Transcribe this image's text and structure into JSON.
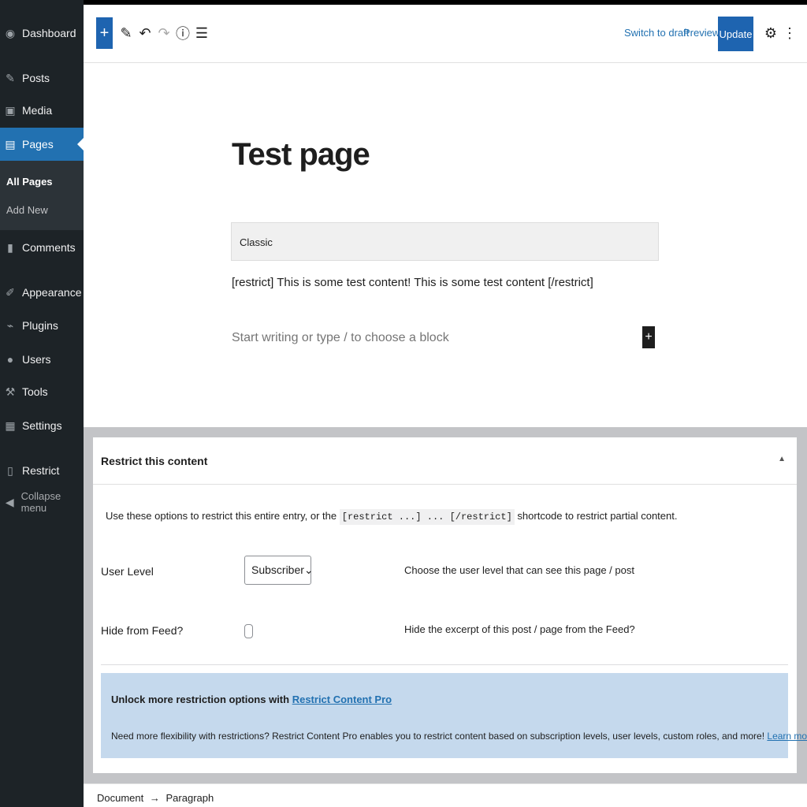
{
  "sidebar": {
    "items": [
      {
        "label": "Dashboard",
        "icon": "dashboard-icon"
      },
      {
        "label": "Posts",
        "icon": "pin-icon"
      },
      {
        "label": "Media",
        "icon": "media-icon"
      },
      {
        "label": "Pages",
        "icon": "pages-icon"
      },
      {
        "label": "Comments",
        "icon": "comment-icon"
      },
      {
        "label": "Appearance",
        "icon": "brush-icon"
      },
      {
        "label": "Plugins",
        "icon": "plugin-icon"
      },
      {
        "label": "Users",
        "icon": "user-icon"
      },
      {
        "label": "Tools",
        "icon": "wrench-icon"
      },
      {
        "label": "Settings",
        "icon": "settings-icon"
      },
      {
        "label": "Restrict",
        "icon": "restrict-icon"
      }
    ],
    "submenu": {
      "all_pages": "All Pages",
      "add_new": "Add New"
    },
    "collapse": "Collapse menu"
  },
  "toolbar": {
    "add_block": "+",
    "switch_to_draft": "Switch to draft",
    "preview": "Preview",
    "update": "Update"
  },
  "editor": {
    "title": "Test page",
    "classic_label": "Classic",
    "content": "[restrict] This is some test content! This is some test content [/restrict]",
    "placeholder": "Start writing or type / to choose a block"
  },
  "metabox": {
    "title": "Restrict this content",
    "intro_before": "Use these options to restrict this entire entry, or the",
    "code": "[restrict ...] ... [/restrict]",
    "intro_after": "shortcode to restrict partial content.",
    "user_level_label": "User Level",
    "user_level_value": "Subscriber",
    "user_level_desc": "Choose the user level that can see this page / post",
    "hide_feed_label": "Hide from Feed?",
    "hide_feed_desc": "Hide the excerpt of this post / page from the Feed?",
    "promo_title": "Unlock more restriction options with",
    "promo_link": "Restrict Content Pro",
    "promo_text": "Need more flexibility with restrictions? Restrict Content Pro enables you to restrict content based on subscription levels, user levels, custom roles, and more!",
    "promo_learn": "Learn more..."
  },
  "breadcrumb": {
    "document": "Document",
    "arrow": "→",
    "paragraph": "Paragraph"
  },
  "colors": {
    "accent": "#2271b1",
    "sidebar": "#1d2327",
    "promo": "#c5d9ed"
  }
}
